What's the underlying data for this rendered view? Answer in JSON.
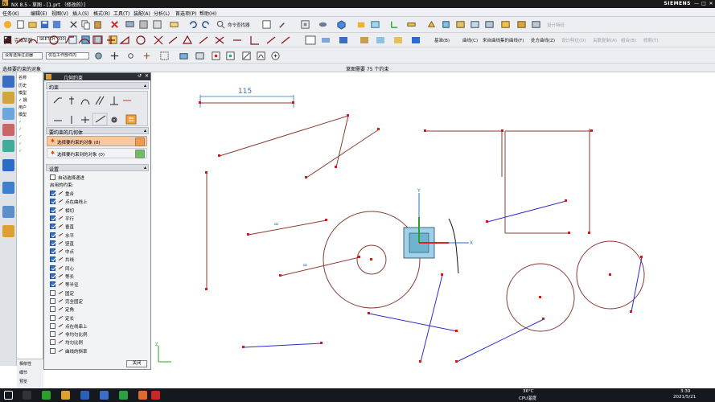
{
  "window": {
    "title": "NX 8.5 - 草图 - [1.prt （修改的）]",
    "brand": "SIEMENS",
    "controls": [
      "—",
      "□",
      "✕"
    ]
  },
  "menu": {
    "items": [
      "任务(K)",
      "编辑(E)",
      "视图(V)",
      "插入(S)",
      "格式(R)",
      "工具(T)",
      "装配(A)",
      "分析(L)",
      "首选项(P)",
      "帮助(H)"
    ]
  },
  "toolbar1": {
    "order_command": "命令查找器",
    "design_feature": "设计特征"
  },
  "toolbar2": {
    "finish_sketch": "完成草图",
    "sketch_combo": "SKETCH_000",
    "texts": [
      "基准(B)",
      "曲线(C)",
      "来自曲线集的曲线(F)",
      "处方曲线(Z)",
      "设计特征(D)",
      "关联复制(A)",
      "组合(B)",
      "修剪(T)"
    ]
  },
  "toolbar3": {
    "filter_combo": "没有选择过滤器",
    "scope_combo": "仅在工作部件内"
  },
  "status": {
    "prompt": "选择要约束的对象",
    "center": "草图需要 75 个约束"
  },
  "nav": {
    "rows": [
      "名称",
      "历史",
      "模型",
      "✓ 摄",
      "用户",
      "模型",
      "✓",
      "✓",
      "✓",
      "✓",
      "✓"
    ]
  },
  "dialog": {
    "title": "几何约束",
    "section_constraint": "约束",
    "section_geometry": "要约束的几何体",
    "select_object": "选择要约束的对象 (0)",
    "select_target": "选择要约束到的对象 (0)",
    "section_settings": "设置",
    "auto_select": "自动选择递进",
    "enabled_label": "启用的约束:",
    "constraints": [
      {
        "label": "重合",
        "checked": true,
        "glyph": "coincident-icon"
      },
      {
        "label": "点在曲线上",
        "checked": true,
        "glyph": "point-on-curve-icon"
      },
      {
        "label": "相切",
        "checked": true,
        "glyph": "tangent-icon"
      },
      {
        "label": "平行",
        "checked": true,
        "glyph": "parallel-icon"
      },
      {
        "label": "垂直",
        "checked": true,
        "glyph": "perpendicular-icon"
      },
      {
        "label": "水平",
        "checked": true,
        "glyph": "horizontal-icon"
      },
      {
        "label": "竖直",
        "checked": true,
        "glyph": "vertical-icon"
      },
      {
        "label": "中点",
        "checked": true,
        "glyph": "midpoint-icon"
      },
      {
        "label": "共线",
        "checked": true,
        "glyph": "collinear-icon"
      },
      {
        "label": "同心",
        "checked": true,
        "glyph": "concentric-icon"
      },
      {
        "label": "等长",
        "checked": true,
        "glyph": "equal-length-icon"
      },
      {
        "label": "等半径",
        "checked": true,
        "glyph": "equal-radius-icon"
      },
      {
        "label": "固定",
        "checked": false,
        "glyph": "fixed-icon"
      },
      {
        "label": "完全固定",
        "checked": false,
        "glyph": "fully-fixed-icon"
      },
      {
        "label": "定角",
        "checked": false,
        "glyph": "constant-angle-icon"
      },
      {
        "label": "定长",
        "checked": false,
        "glyph": "constant-length-icon"
      },
      {
        "label": "点在线串上",
        "checked": false,
        "glyph": "point-on-string-icon"
      },
      {
        "label": "非均匀比例",
        "checked": false,
        "glyph": "nonuniform-scale-icon"
      },
      {
        "label": "均匀比例",
        "checked": false,
        "glyph": "uniform-scale-icon"
      },
      {
        "label": "曲线的斜率",
        "checked": false,
        "glyph": "curve-slope-icon"
      }
    ],
    "close": "关闭"
  },
  "canvas": {
    "dimension_label": "115",
    "equal_marks": [
      "=",
      "="
    ],
    "axis_x": "X",
    "axis_y": "Y",
    "axis_z": "Z"
  },
  "bottom_left": {
    "items": [
      "相依性",
      "细节",
      "预览"
    ]
  },
  "taskbar": {
    "temp": "36°C",
    "cpu": "CPU温度",
    "time": "3:39",
    "date": "2021/5/21"
  },
  "colors": {
    "sketch_curve": "#8a3b33",
    "constraint_blue": "#2b2bd0",
    "endpoint_red": "#e01414",
    "title_dark": "#2b2f35"
  }
}
